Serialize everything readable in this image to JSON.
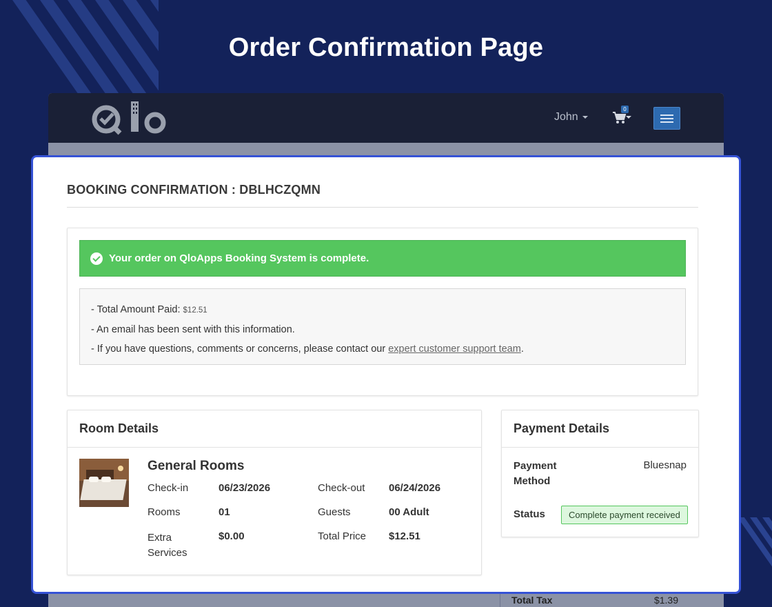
{
  "page": {
    "title": "Order Confirmation Page"
  },
  "navbar": {
    "user_label": "John",
    "cart_count": "0",
    "logo_text": "Qlo"
  },
  "booking": {
    "heading": "BOOKING CONFIRMATION : DBLHCZQMN",
    "success_message": "Your order on QloApps Booking System is complete.",
    "info": {
      "line1_prefix": "- Total Amount Paid: ",
      "line1_amount": "$12.51",
      "line2": "- An email has been sent with this information.",
      "line3_prefix": "- If you have questions, comments or concerns, please contact our ",
      "line3_link": "expert customer support team",
      "line3_suffix": "."
    }
  },
  "room_details": {
    "title": "Room Details",
    "room_name": "General Rooms",
    "labels": {
      "checkin": "Check-in",
      "checkout": "Check-out",
      "rooms": "Rooms",
      "guests": "Guests",
      "extra_services": "Extra Services",
      "total_price": "Total Price"
    },
    "values": {
      "checkin": "06/23/2026",
      "checkout": "06/24/2026",
      "rooms": "01",
      "guests": "00 Adult",
      "extra_services": "$0.00",
      "total_price": "$12.51"
    }
  },
  "payment_details": {
    "title": "Payment Details",
    "method_label": "Payment Method",
    "method_value": "Bluesnap",
    "status_label": "Status",
    "status_value": "Complete payment received"
  },
  "background_table": {
    "total_tax_label": "Total Tax",
    "total_tax_value": "$1.39"
  },
  "colors": {
    "background": "#13225a",
    "success": "#55c65e",
    "accent_border": "#3552d6",
    "navbar": "#1a2036",
    "menu_button": "#2d6ab0"
  }
}
